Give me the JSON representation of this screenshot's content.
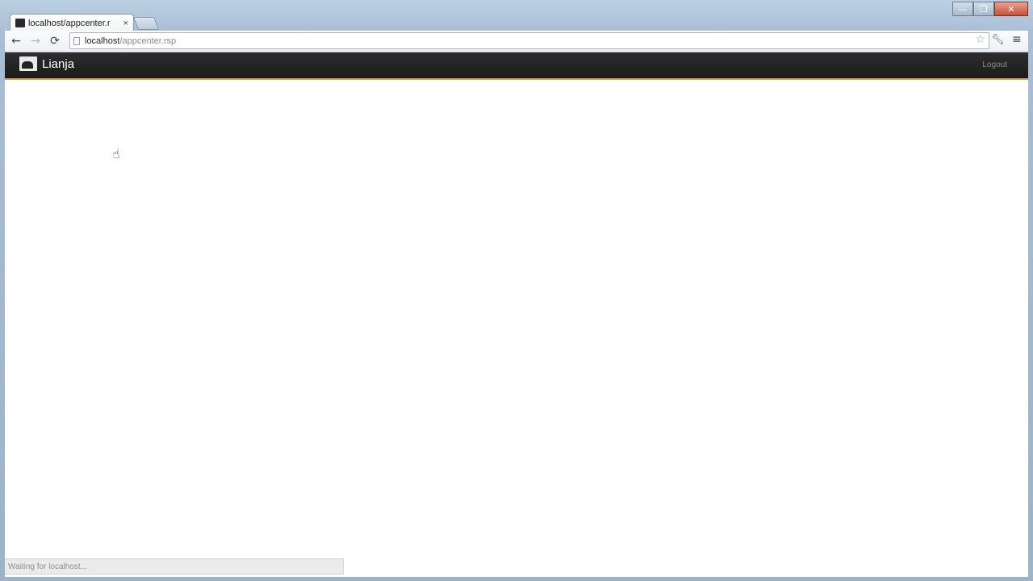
{
  "browser": {
    "tab": {
      "title": "localhost/appcenter.r",
      "close": "×"
    },
    "toolbar": {
      "back": "←",
      "forward": "→",
      "reload": "⟳",
      "star": "☆",
      "wrench": "🔧",
      "menu": "≡"
    },
    "address": {
      "host": "localhost",
      "path": "/appcenter.rsp"
    },
    "window_controls": {
      "minimize": "—",
      "maximize": "❐",
      "close": "✕"
    },
    "status": "Waiting for localhost..."
  },
  "app": {
    "brand": "Lianja",
    "logout": "Logout",
    "accent_color": "#e8a33a",
    "navbar_color": "#1f1f1f"
  },
  "icons": {
    "cursor": "hand-pointer-cursor"
  }
}
